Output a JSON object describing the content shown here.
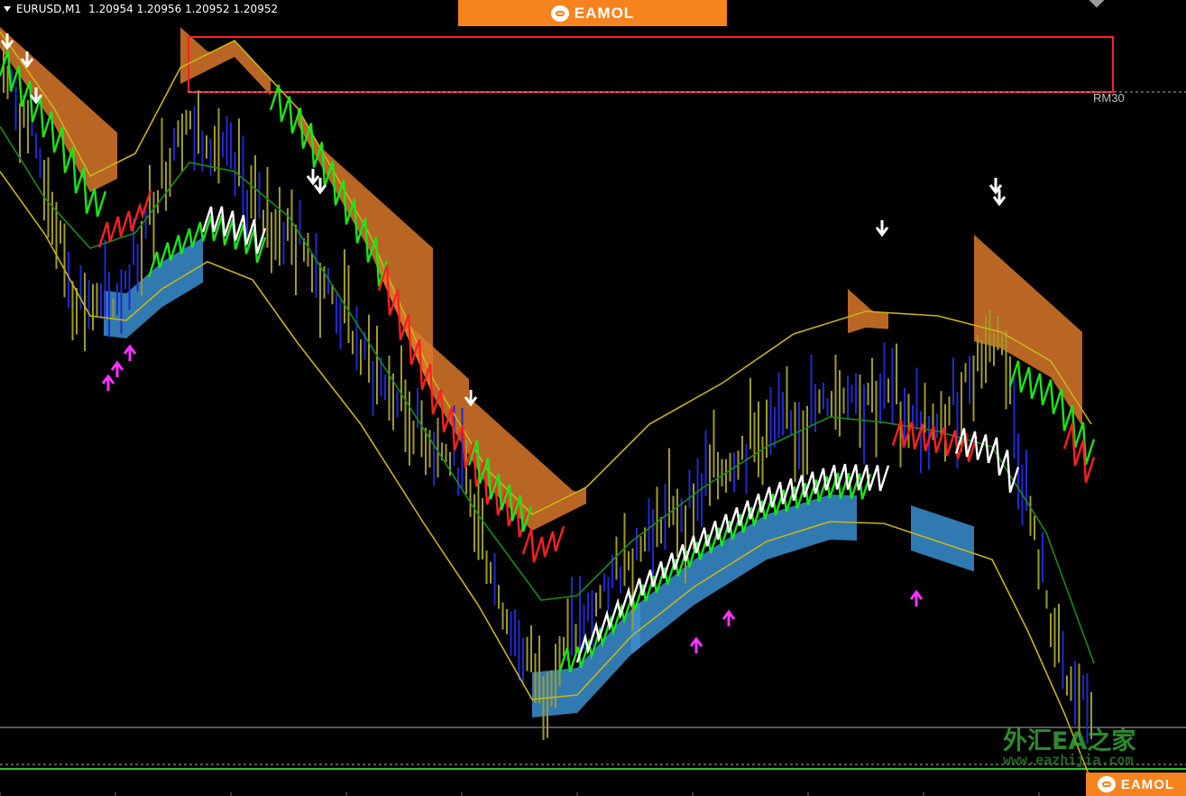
{
  "symbol": {
    "name": "EURUSD,M1",
    "prices": "1.20954 1.20956 1.20952 1.20952"
  },
  "logo": {
    "text": "EAMOL"
  },
  "levels": {
    "rm_label": "RM30"
  },
  "watermark": {
    "chinese": "外汇EA之家",
    "url": "www.eazhijia.com"
  },
  "colors": {
    "background": "#000000",
    "band_yellow": "#c8b418",
    "middle_green": "#1a8c1a",
    "price_up": "#19e619",
    "price_down": "#ff2020",
    "price_neutral": "#ffffff",
    "candle_olive": "#9e9a2a",
    "candle_blue": "#1e2ad0",
    "cloud_orange": "#d9782a",
    "cloud_blue": "#3a8fd0",
    "arrow_up": "#ff33ff",
    "arrow_down": "#ffffff",
    "resistance_box": "#ff2020",
    "logo_bg": "#f7831f"
  }
}
